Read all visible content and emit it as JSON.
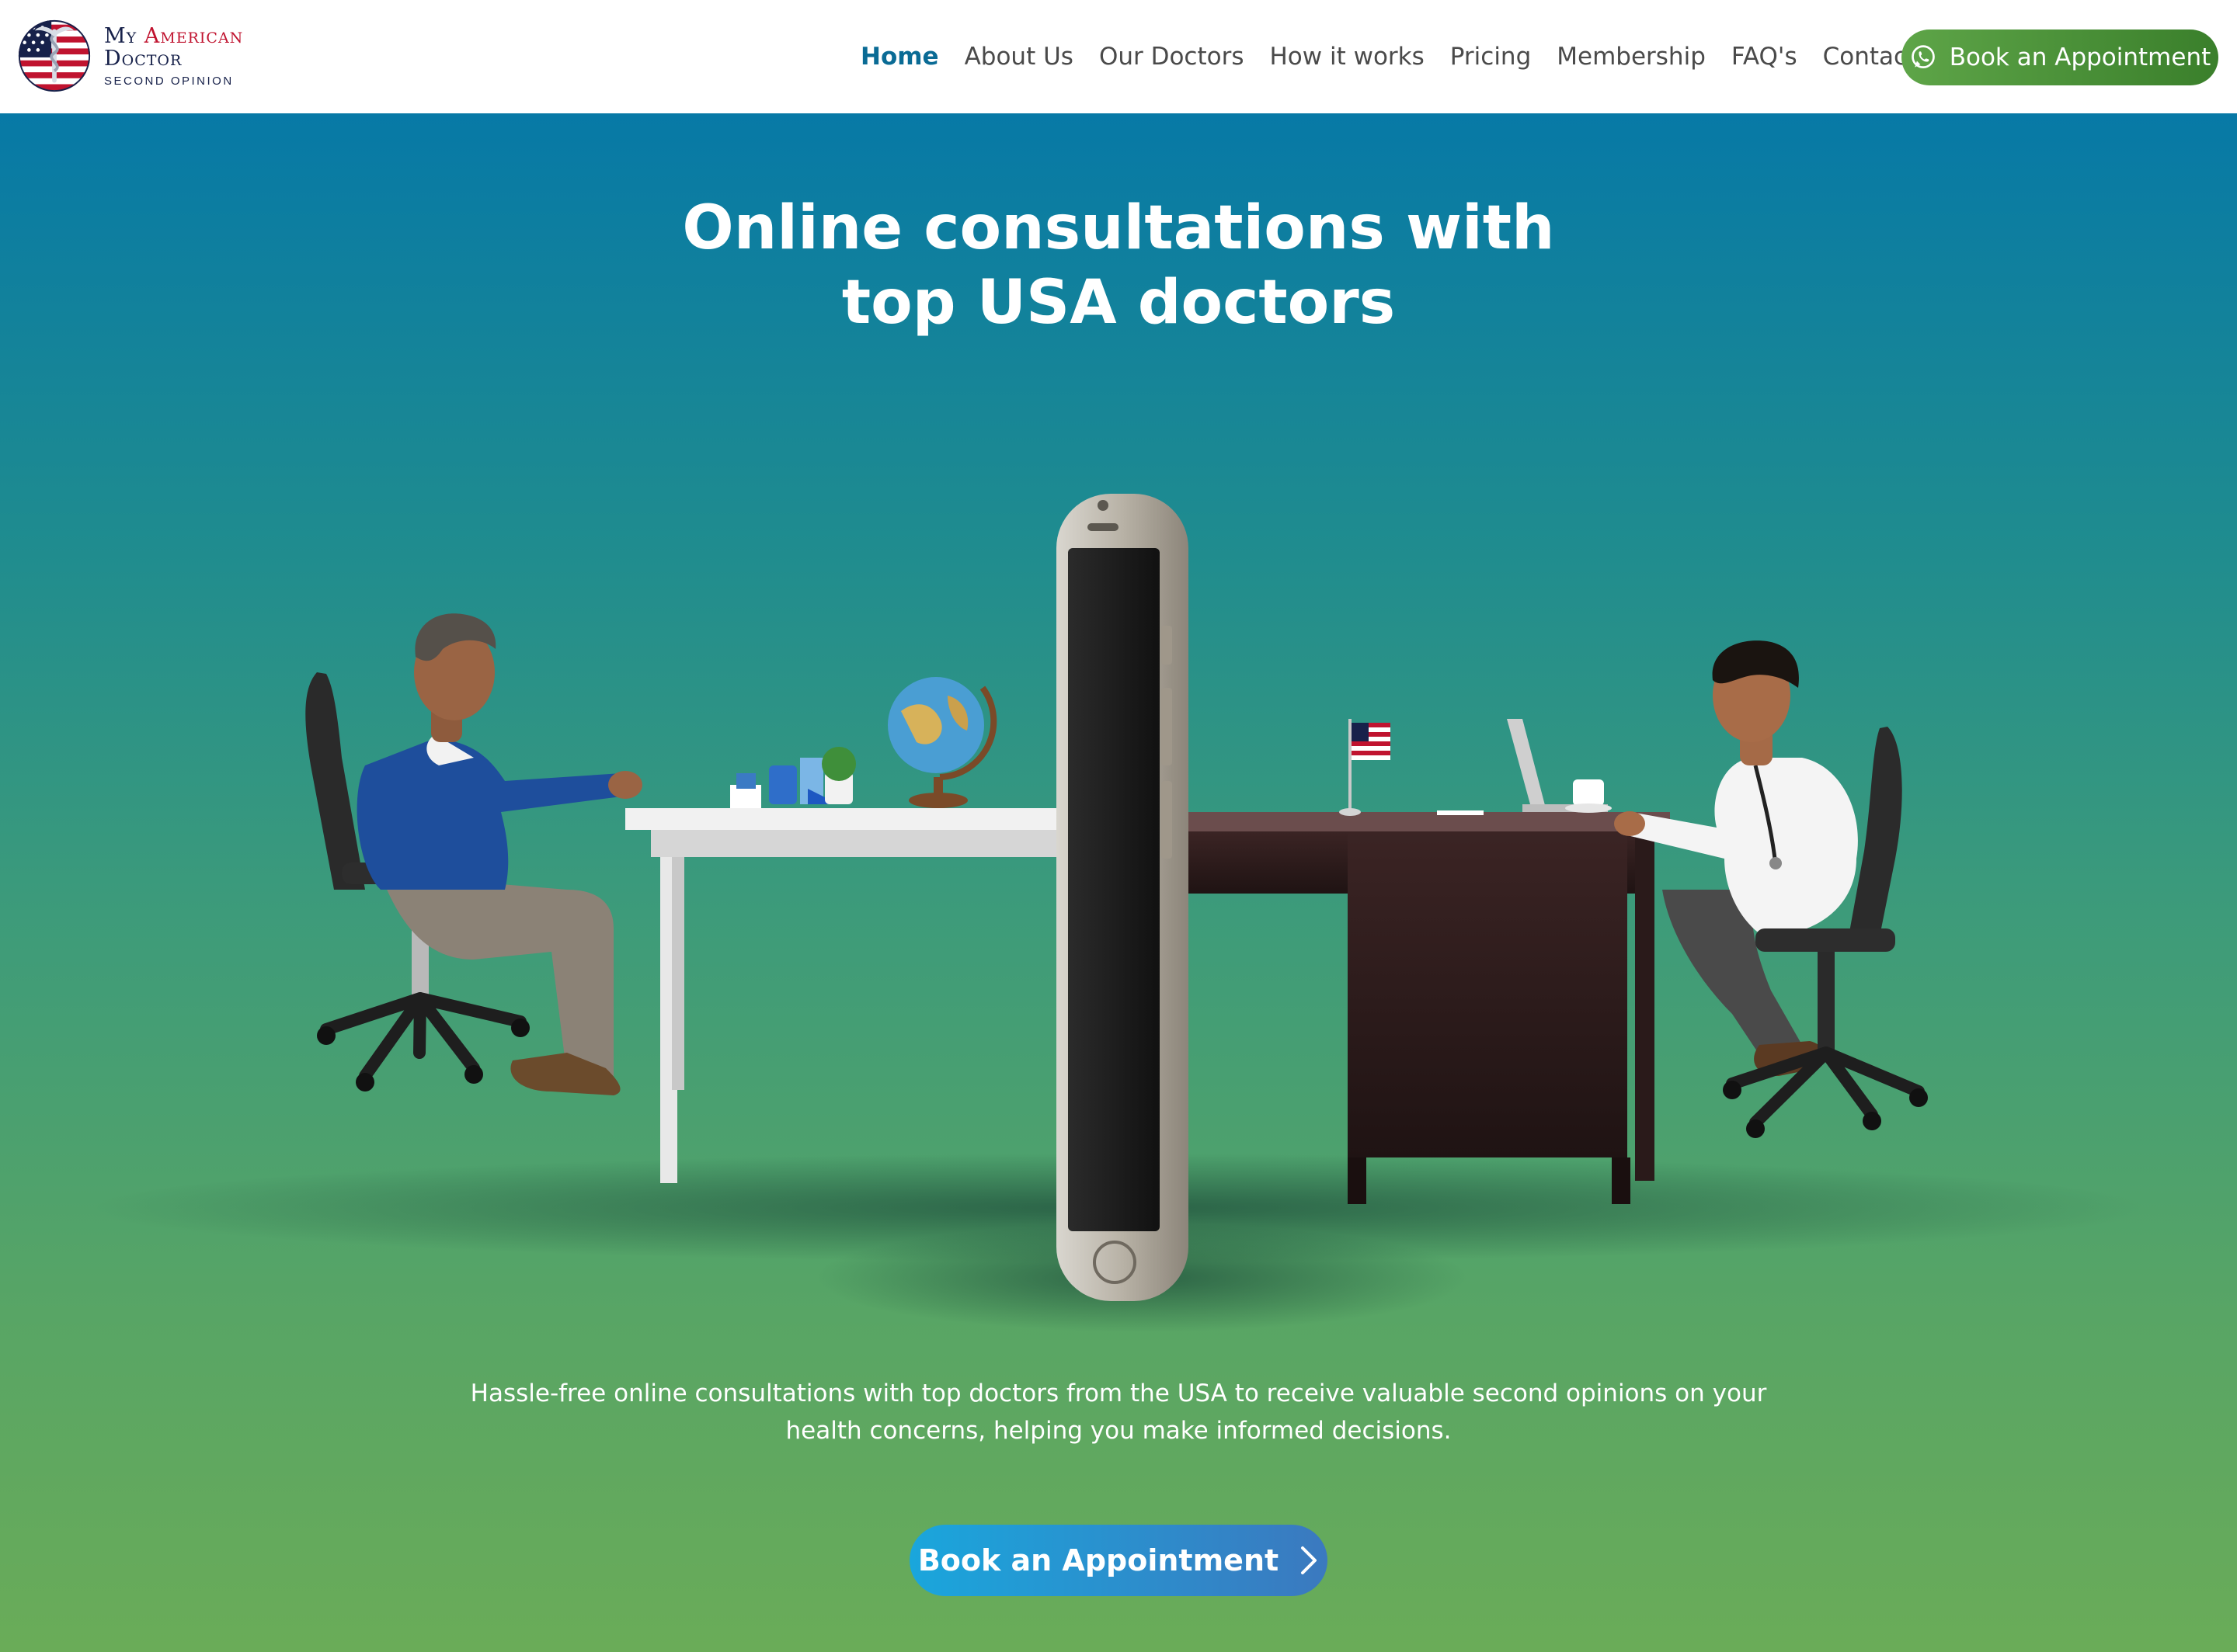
{
  "brand": {
    "name_line1_part1": "My ",
    "name_line1_part2": "American",
    "name_line2": "Doctor",
    "tagline": "Second Opinion"
  },
  "nav": {
    "items": [
      {
        "label": "Home",
        "active": true
      },
      {
        "label": "About Us",
        "active": false
      },
      {
        "label": "Our Doctors",
        "active": false
      },
      {
        "label": "How it works",
        "active": false
      },
      {
        "label": "Pricing",
        "active": false
      },
      {
        "label": "Membership",
        "active": false
      },
      {
        "label": "FAQ's",
        "active": false
      },
      {
        "label": "Contact Us",
        "active": false
      }
    ],
    "book_button": {
      "label": "Book an Appointment",
      "icon": "whatsapp-icon"
    }
  },
  "hero": {
    "title_line1": "Online consultations with",
    "title_line2": "top USA doctors",
    "description_line1": "Hassle-free online consultations with top doctors from the USA to receive valuable second opinions on your",
    "description_line2": "health concerns, helping you make informed decisions.",
    "cta": {
      "label": "Book an Appointment",
      "icon": "chevron-right-icon"
    }
  },
  "colors": {
    "active_nav": "#0a6b95",
    "header_button": "#4e9a3b",
    "cta_start": "#1aa6dc",
    "cta_end": "#3b79bf",
    "hero_top": "#0779a6",
    "hero_bottom": "#6aac58",
    "brand_red": "#c0132f",
    "brand_navy": "#17214a"
  }
}
